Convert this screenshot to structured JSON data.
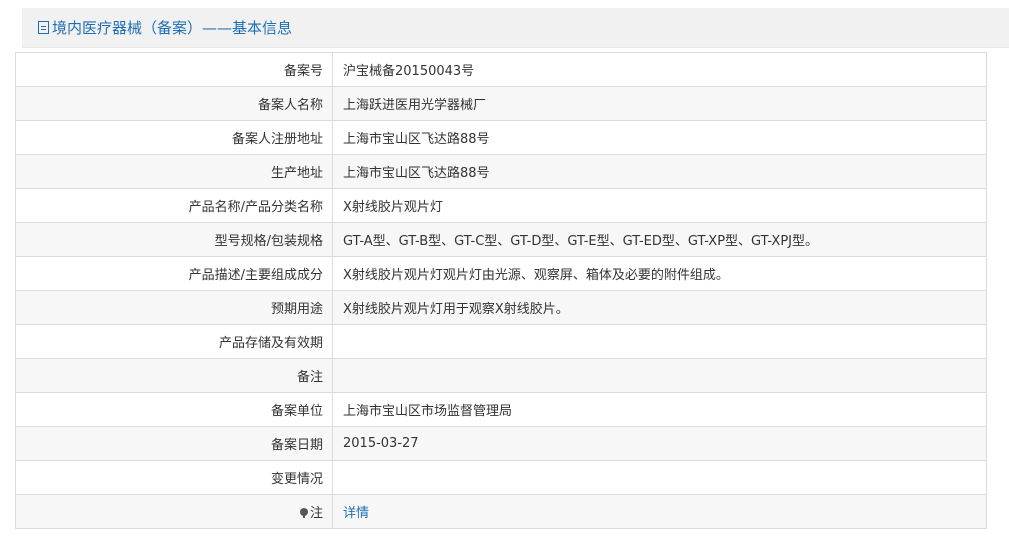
{
  "header": {
    "title": "境内医疗器械（备案）——基本信息",
    "icon": "document-icon"
  },
  "rows": [
    {
      "label": "备案号",
      "value": "沪宝械备20150043号"
    },
    {
      "label": "备案人名称",
      "value": "上海跃进医用光学器械厂"
    },
    {
      "label": "备案人注册地址",
      "value": "上海市宝山区飞达路88号"
    },
    {
      "label": "生产地址",
      "value": "上海市宝山区飞达路88号"
    },
    {
      "label": "产品名称/产品分类名称",
      "value": "X射线胶片观片灯"
    },
    {
      "label": "型号规格/包装规格",
      "value": "GT-A型、GT-B型、GT-C型、GT-D型、GT-E型、GT-ED型、GT-XP型、GT-XPJ型。"
    },
    {
      "label": "产品描述/主要组成成分",
      "value": "X射线胶片观片灯观片灯由光源、观察屏、箱体及必要的附件组成。"
    },
    {
      "label": "预期用途",
      "value": "X射线胶片观片灯用于观察X射线胶片。"
    },
    {
      "label": "产品存储及有效期",
      "value": ""
    },
    {
      "label": "备注",
      "value": ""
    },
    {
      "label": "备案单位",
      "value": "上海市宝山区市场监督管理局"
    },
    {
      "label": "备案日期",
      "value": "2015-03-27"
    },
    {
      "label": "变更情况",
      "value": ""
    }
  ],
  "note": {
    "label": "注",
    "icon": "pin-icon",
    "link_text": "详情"
  },
  "colors": {
    "accent": "#1f6fb5",
    "header_bg": "#f1f1f1",
    "border": "#dcdcdc",
    "stripe": "#f7f7f7"
  }
}
